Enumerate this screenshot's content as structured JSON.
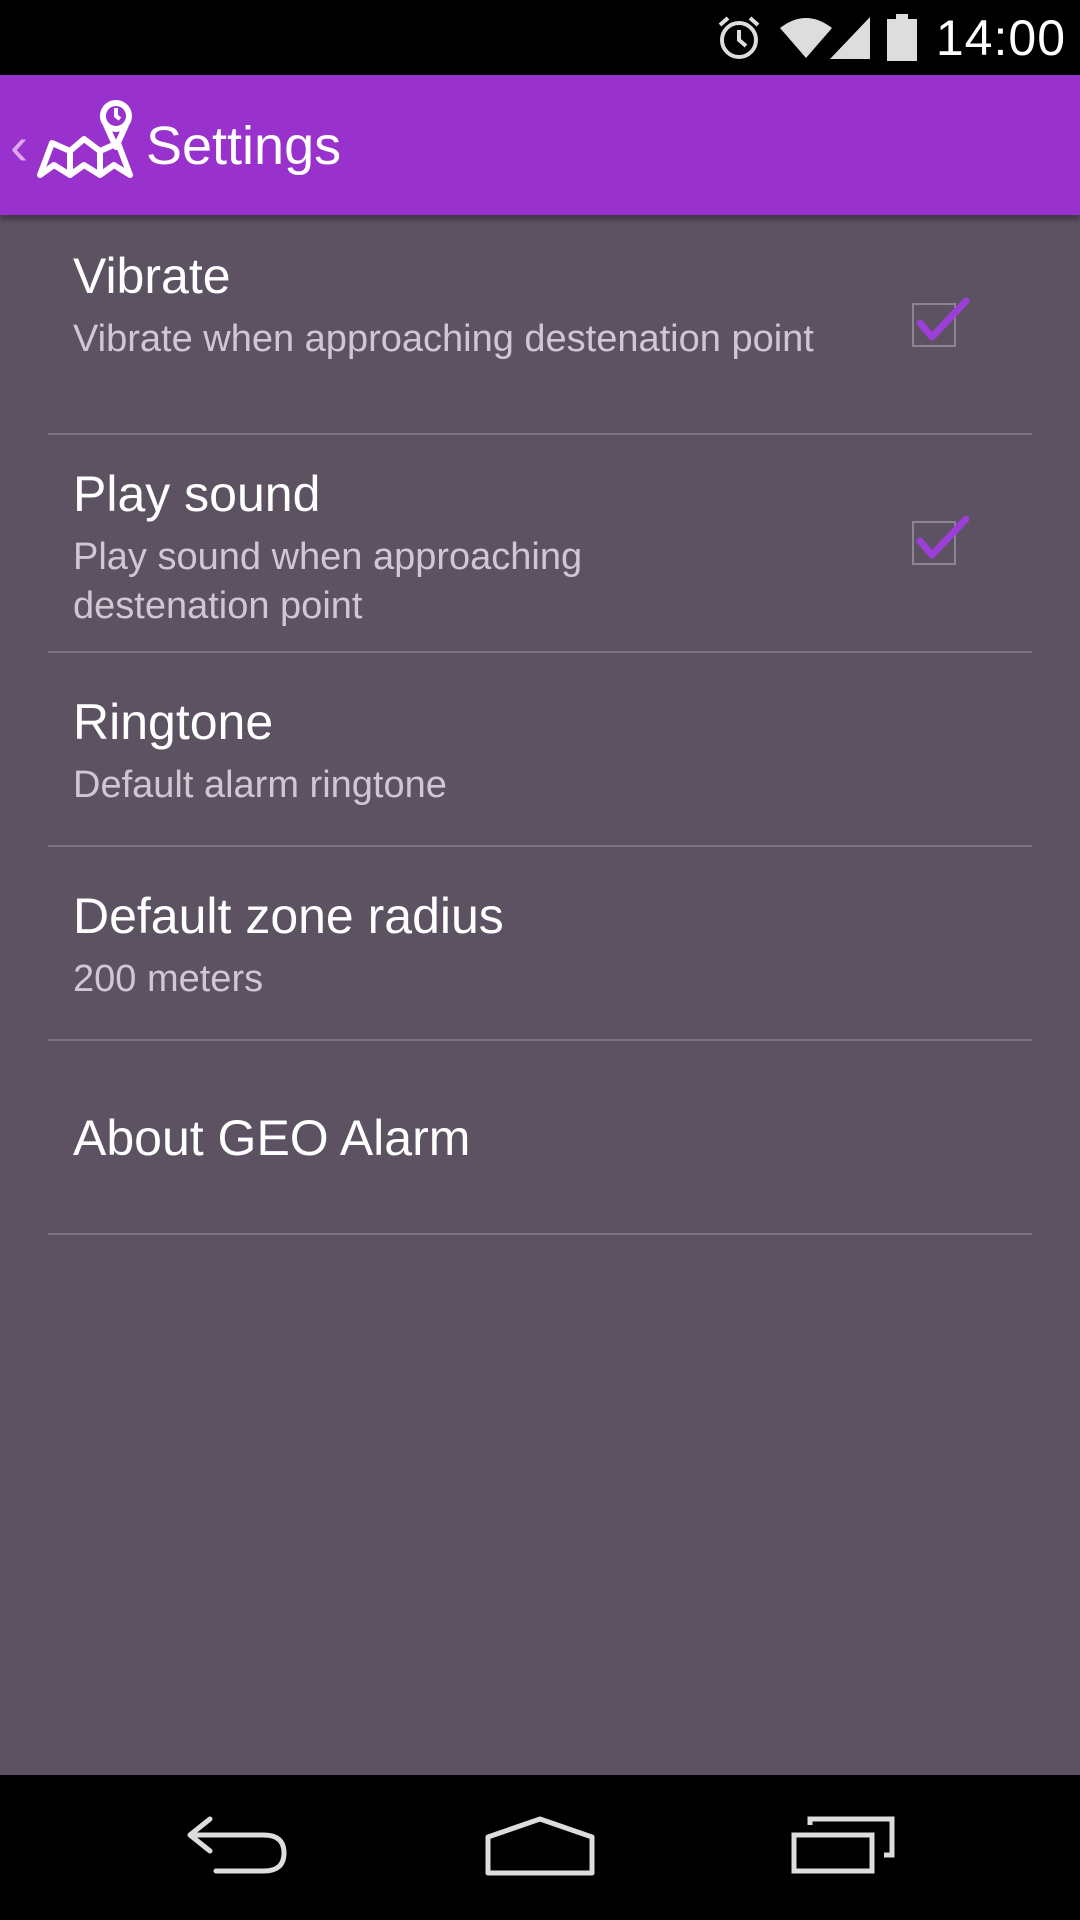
{
  "status_bar": {
    "time": "14:00",
    "icons": [
      "alarm-clock-icon",
      "wifi-icon",
      "signal-icon",
      "battery-icon"
    ]
  },
  "action_bar": {
    "title": "Settings",
    "up_icon": "chevron-left-icon",
    "app_icon": "geo-alarm-map-pin-icon",
    "color": "#9932cc"
  },
  "preferences": [
    {
      "title": "Vibrate",
      "summary": "Vibrate when approaching destenation point",
      "checked": true
    },
    {
      "title": "Play sound",
      "summary": "Play sound when approaching destenation point",
      "checked": true
    },
    {
      "title": "Ringtone",
      "summary": "Default alarm ringtone"
    },
    {
      "title": "Default zone radius",
      "summary": "200 meters"
    },
    {
      "title": "About GEO Alarm"
    }
  ],
  "nav_bar": {
    "icons": [
      "back-icon",
      "home-icon",
      "recent-apps-icon"
    ]
  },
  "colors": {
    "background": "#5c5262",
    "accent": "#9932cc",
    "check": "#9c3fd6"
  }
}
